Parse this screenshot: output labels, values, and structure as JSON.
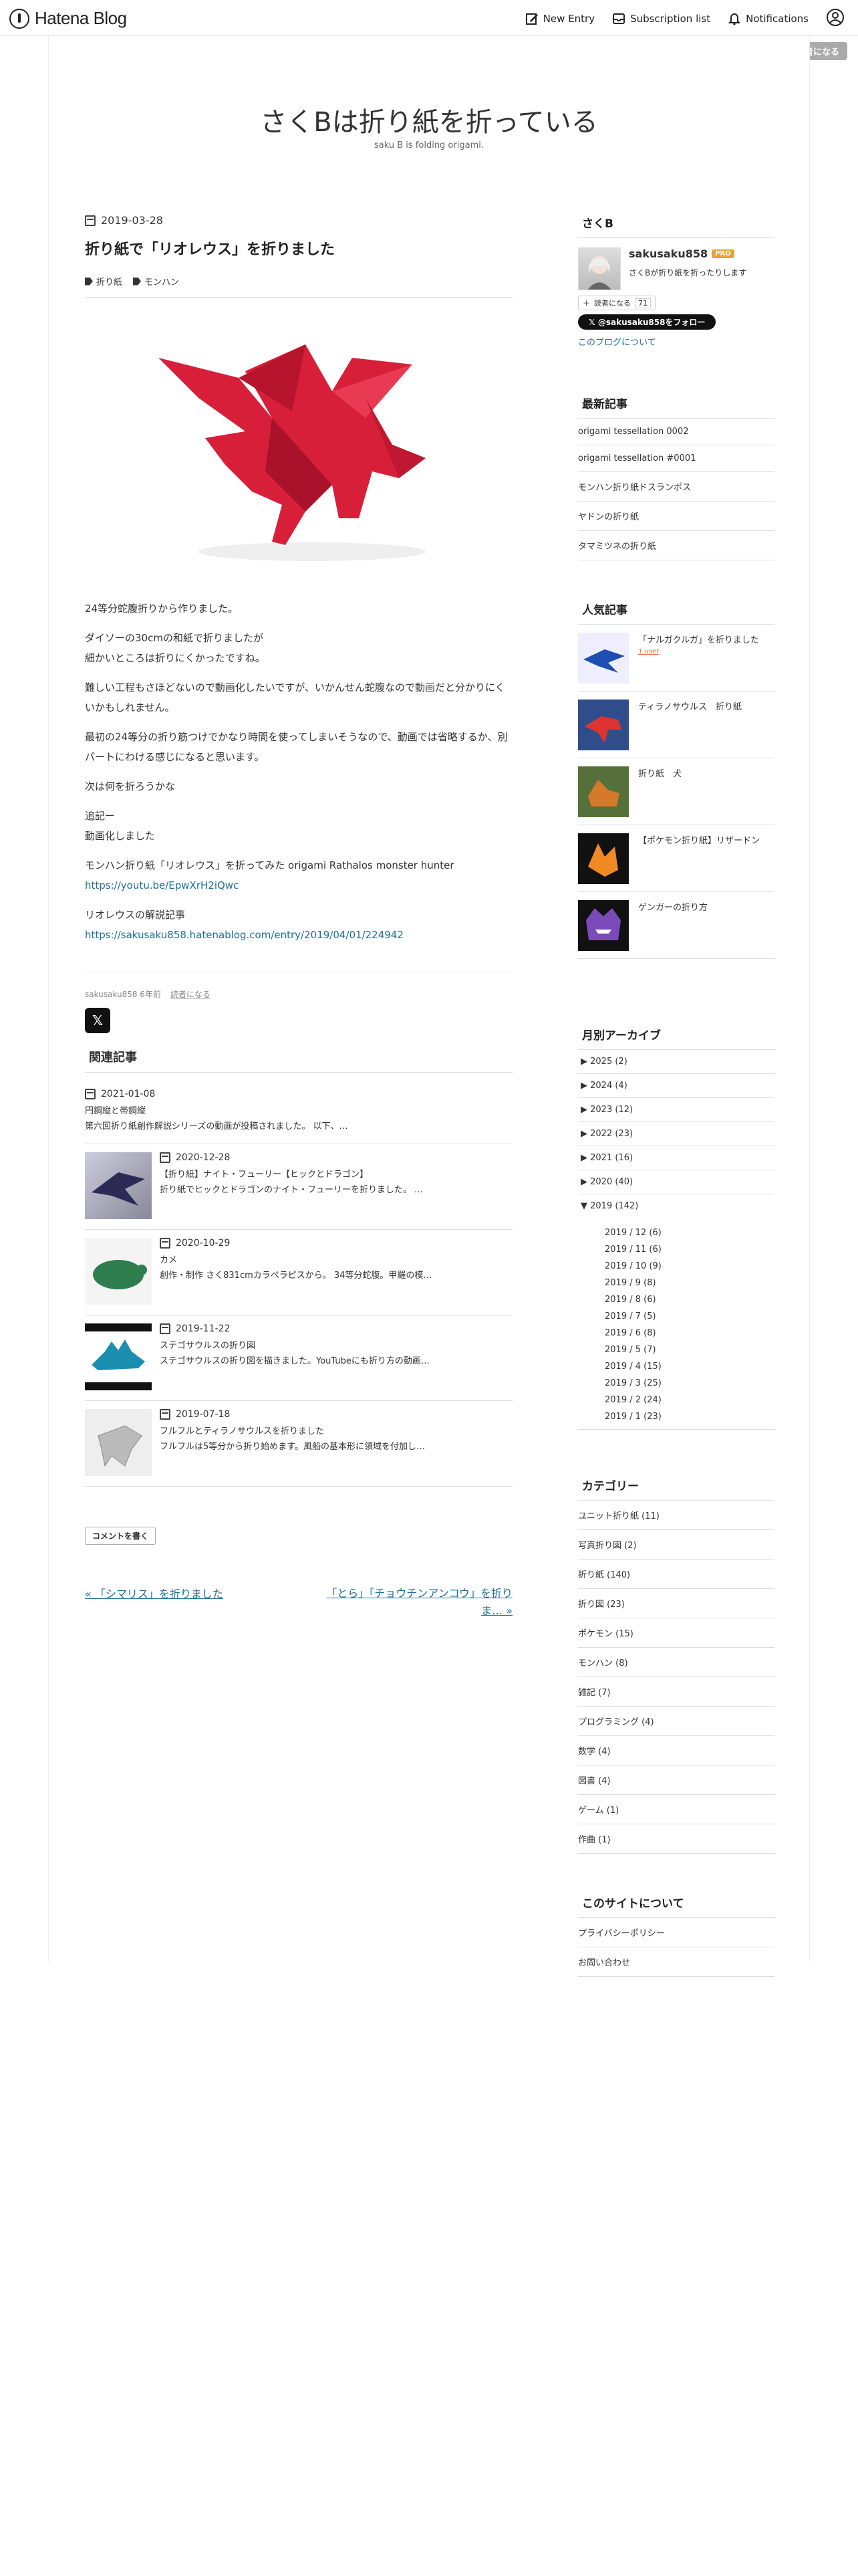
{
  "topbar": {
    "logo": "Hatena Blog",
    "new_entry": "New Entry",
    "subscription": "Subscription list",
    "notifications": "Notifications",
    "reader_button": "読者になる"
  },
  "blog": {
    "title": "さくBは折り紙を折っている",
    "description": "saku B is folding origami."
  },
  "entry": {
    "date": "2019-03-28",
    "title": "折り紙で「リオレウス」を折りました",
    "categories": [
      "折り紙",
      "モンハン"
    ],
    "paragraphs": [
      "24等分蛇腹折りから作りました。",
      "ダイソーの30cmの和紙で折りましたが\n細かいところは折りにくかったですね。",
      "難しい工程もさほどないので動画化したいですが、いかんせん蛇腹なので動画だと分かりにくいかもしれません。",
      "最初の24等分の折り筋つけでかなり時間を使ってしまいそうなので、動画では省略するか、別パートにわける感じになると思います。",
      "次は何を折ろうかな",
      "追記ー\n動画化しました",
      "モンハン折り紙「リオレウス」を折ってみた origami Rathalos monster hunter"
    ],
    "video_link": "https://youtu.be/EpwXrH2iQwc",
    "guide_label": "リオレウスの解説記事",
    "guide_link": "https://sakusaku858.hatenablog.com/entry/2019/04/01/224942",
    "author_meta": "sakusaku858 6年前",
    "reader_meta": "読者になる",
    "x_label": "𝕏"
  },
  "related": {
    "heading": "関連記事",
    "first": {
      "date": "2021-01-08",
      "title": "円鋼縦と帯鋼縦",
      "excerpt": "第六回折り紙創作解説シリーズの動画が投稿されました。 以下、…"
    },
    "items": [
      {
        "date": "2020-12-28",
        "title": "【折り紙】ナイト・フューリー【ヒックとドラゴン】",
        "excerpt": "折り紙でヒックとドラゴンのナイト・フューリーを折りました。 …"
      },
      {
        "date": "2020-10-29",
        "title": "カメ",
        "excerpt": "創作・制作 さく831cmカラペラピスから。 34等分蛇腹。甲羅の模…"
      },
      {
        "date": "2019-11-22",
        "title": "ステゴサウルスの折り図",
        "excerpt": "ステゴサウルスの折り図を描きました。YouTubeにも折り方の動画…"
      },
      {
        "date": "2019-07-18",
        "title": "フルフルとティラノサウルスを折りました",
        "excerpt": "フルフルは5等分から折り始めます。風船の基本形に領域を付加し…"
      }
    ]
  },
  "comment_button": "コメントを書く",
  "pager": {
    "prev": "« 「シマリス」を折りました",
    "next": "「とら」「チョウチンアンコウ」を折りま… »"
  },
  "sidebar": {
    "profile_head": "さくB",
    "profile_name": "sakusaku858",
    "pro_badge": "PRO",
    "profile_desc": "さくBが折り紙を折ったりします",
    "reader_label": "読者になる",
    "reader_count": "71",
    "follow_label": "@sakusaku858をフォロー",
    "about_label": "このブログについて",
    "recent_head": "最新記事",
    "recent": [
      "origami tessellation 0002",
      "origami tessellation #0001",
      "モンハン折り紙ドスランポス",
      "ヤドンの折り紙",
      "タマミツネの折り紙"
    ],
    "popular_head": "人気記事",
    "popular": [
      {
        "title": "「ナルガクルガ」を折りました",
        "bm": "1 user"
      },
      {
        "title": "ティラノサウルス　折り紙",
        "bm": ""
      },
      {
        "title": "折り紙　犬",
        "bm": ""
      },
      {
        "title": "【ポケモン折り紙】リザードン",
        "bm": ""
      },
      {
        "title": "ゲンガーの折り方",
        "bm": ""
      }
    ],
    "archive_head": "月別アーカイブ",
    "archive_years": [
      "▶ 2025 (2)",
      "▶ 2024 (4)",
      "▶ 2023 (12)",
      "▶ 2022 (23)",
      "▶ 2021 (16)",
      "▶ 2020 (40)"
    ],
    "archive_open": "▼ 2019 (142)",
    "archive_months": [
      "2019 / 12 (6)",
      "2019 / 11 (6)",
      "2019 / 10 (9)",
      "2019 / 9 (8)",
      "2019 / 8 (6)",
      "2019 / 7 (5)",
      "2019 / 6 (8)",
      "2019 / 5 (7)",
      "2019 / 4 (15)",
      "2019 / 3 (25)",
      "2019 / 2 (24)",
      "2019 / 1 (23)"
    ],
    "category_head": "カテゴリー",
    "categories": [
      "ユニット折り紙 (11)",
      "写真折り図 (2)",
      "折り紙 (140)",
      "折り図 (23)",
      "ポケモン (15)",
      "モンハン (8)",
      "雑記 (7)",
      "プログラミング (4)",
      "数学 (4)",
      "図書 (4)",
      "ゲーム (1)",
      "作曲 (1)"
    ],
    "site_head": "このサイトについて",
    "site_links": [
      "プライバシーポリシー",
      "お問い合わせ"
    ]
  }
}
